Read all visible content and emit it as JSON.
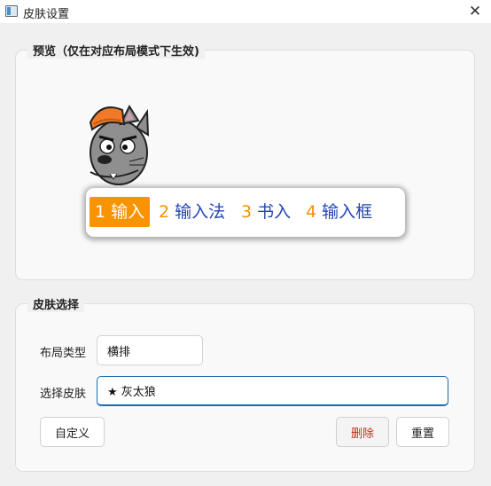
{
  "window": {
    "title": "皮肤设置",
    "close_glyph": "✕"
  },
  "preview": {
    "group_title": "预览（仅在对应布局模式下生效)",
    "candidates": [
      {
        "num": "1",
        "text": "输入",
        "selected": true
      },
      {
        "num": "2",
        "text": "输入法",
        "selected": false
      },
      {
        "num": "3",
        "text": "书入",
        "selected": false
      },
      {
        "num": "4",
        "text": "输入框",
        "selected": false
      }
    ],
    "colors": {
      "accent": "#f79400",
      "candidate_text": "#2447b3",
      "index": "#f29100"
    }
  },
  "skin_select": {
    "group_title": "皮肤选择",
    "layout_type_label": "布局类型",
    "layout_type_value": "横排",
    "skin_label": "选择皮肤",
    "skin_value": "★ 灰太狼",
    "buttons": {
      "custom": "自定义",
      "delete": "删除",
      "reset": "重置"
    }
  }
}
